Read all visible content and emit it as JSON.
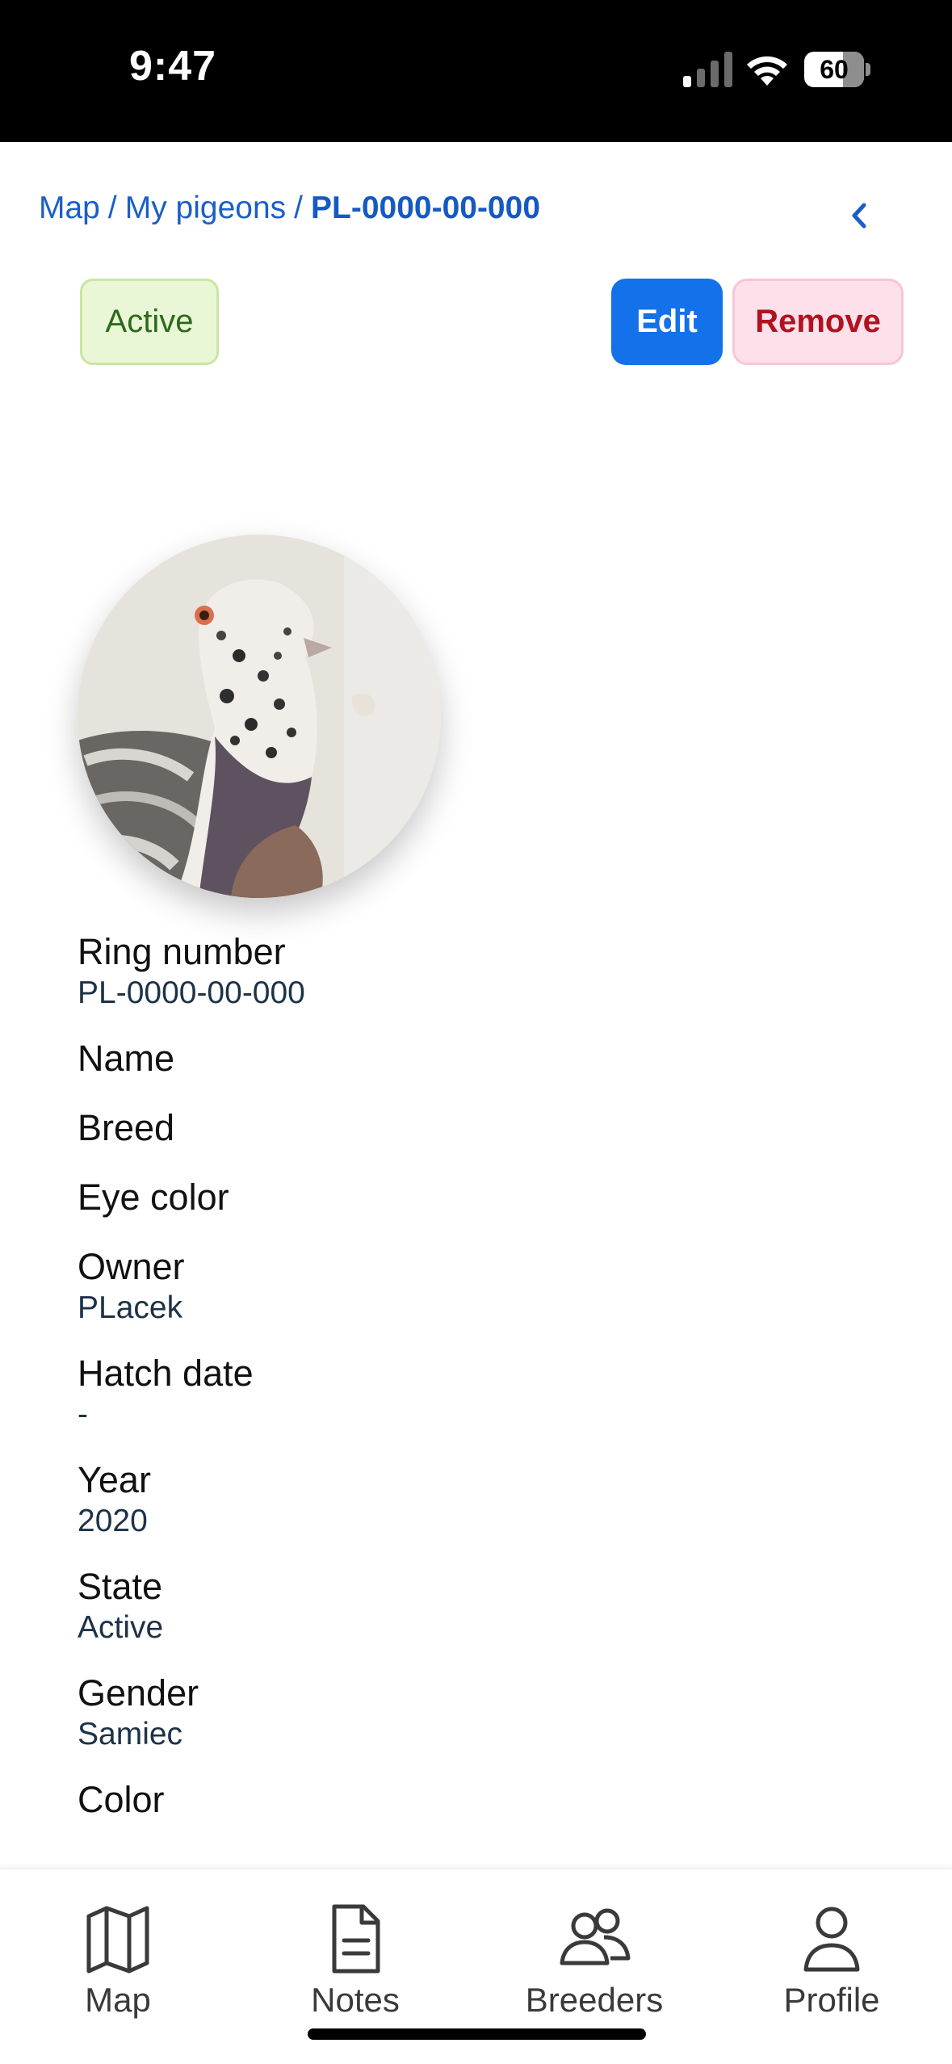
{
  "status_bar": {
    "time": "9:47",
    "battery": "60",
    "battery_level": 0.6
  },
  "breadcrumb": {
    "items": [
      "Map",
      "My pigeons"
    ],
    "separator": "/",
    "current": "PL-0000-00-000"
  },
  "actions": {
    "state_badge": "Active",
    "edit_label": "Edit",
    "remove_label": "Remove"
  },
  "colors": {
    "accent": "#1371e9",
    "link": "#1a5fc7",
    "badge_bg": "#eaf7d6",
    "badge_text": "#2c6a1a",
    "remove_bg": "#fde0ea",
    "remove_text": "#b0131f"
  },
  "avatar": {
    "icon": "pigeon-photo"
  },
  "details": {
    "ring_number": {
      "label": "Ring number",
      "value": "PL-0000-00-000"
    },
    "name": {
      "label": "Name"
    },
    "breed": {
      "label": "Breed"
    },
    "eye_color": {
      "label": "Eye color"
    },
    "owner": {
      "label": "Owner",
      "value": "PLacek"
    },
    "hatch_date": {
      "label": "Hatch date",
      "value": "-"
    },
    "year": {
      "label": "Year",
      "value": "2020"
    },
    "state": {
      "label": "State",
      "value": "Active"
    },
    "gender": {
      "label": "Gender",
      "value": "Samiec"
    },
    "color": {
      "label": "Color"
    }
  },
  "bottom_nav": {
    "items": [
      {
        "label": "Map",
        "icon": "map-icon"
      },
      {
        "label": "Notes",
        "icon": "document-icon"
      },
      {
        "label": "Breeders",
        "icon": "users-icon"
      },
      {
        "label": "Profile",
        "icon": "user-icon"
      }
    ]
  }
}
